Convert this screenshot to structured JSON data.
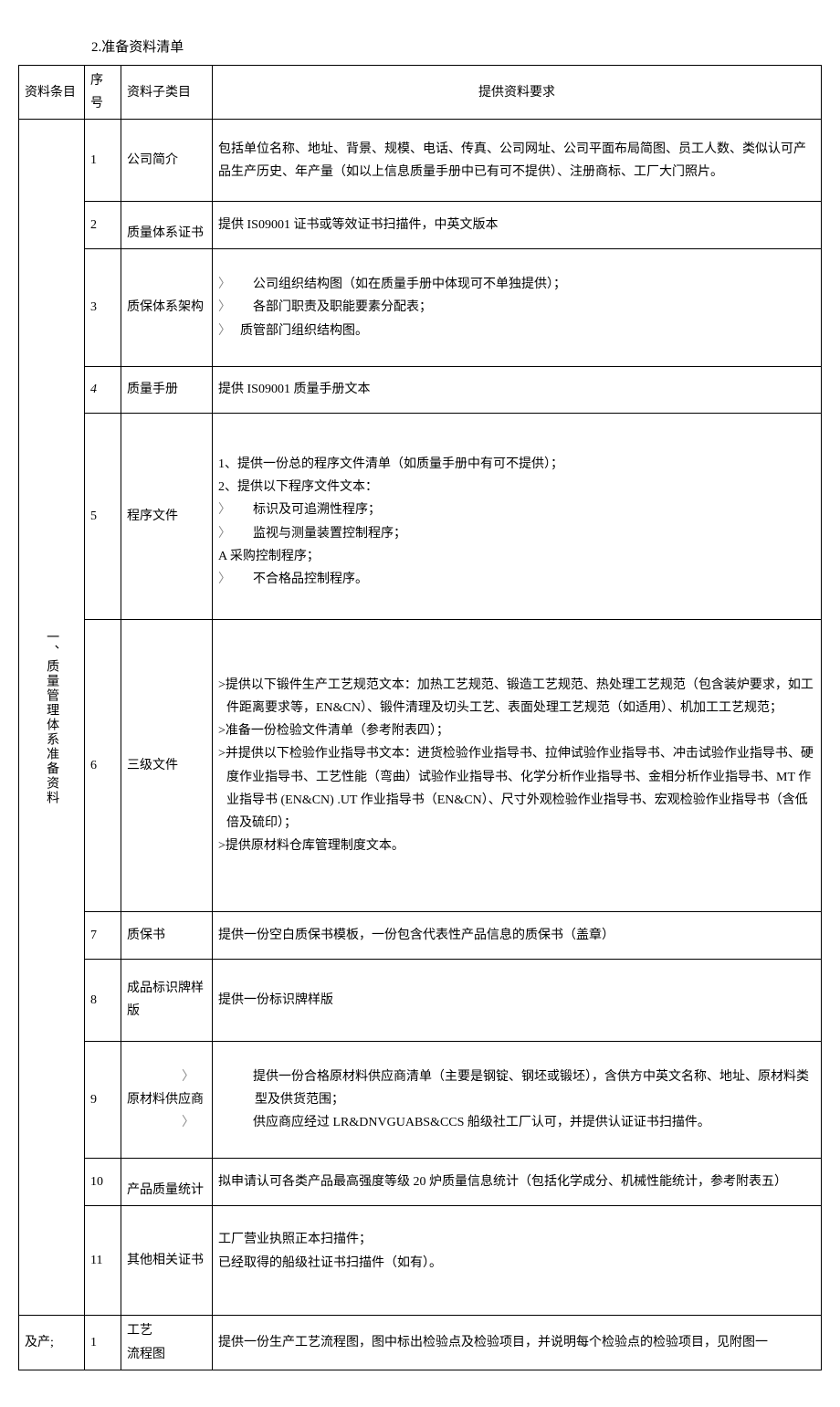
{
  "heading": "2.准备资料清单",
  "header": {
    "col1": "资料条目",
    "col2": "序号",
    "col3": "资料子类目",
    "col4": "提供资料要求"
  },
  "section1_label": "一、质量管理体系准备资料",
  "rows": [
    {
      "seq": "1",
      "cat": "公司简介",
      "req": "包括单位名称、地址、背景、规模、电话、传真、公司网址、公司平面布局简图、员工人数、类似认可产品生产历史、年产量（如以上信息质量手册中已有可不提供）、注册商标、工厂大门照片。"
    },
    {
      "seq": "2",
      "cat": "质量体系证书",
      "req": "提供 IS09001 证书或等效证书扫描件，中英文版本"
    },
    {
      "seq": "3",
      "cat": "质保体系架构",
      "req_lines": [
        {
          "bullet": true,
          "indent": true,
          "text": "公司组织结构图（如在质量手册中体现可不单独提供）；"
        },
        {
          "bullet": true,
          "indent": true,
          "text": "各部门职责及职能要素分配表；"
        },
        {
          "bullet": true,
          "indent": false,
          "text": "质管部门组织结构图。"
        }
      ]
    },
    {
      "seq": "4",
      "seq_italic": true,
      "cat": "质量手册",
      "req": "提供 IS09001 质量手册文本"
    },
    {
      "seq": "5",
      "cat": "程序文件",
      "req_lines": [
        {
          "plain": true,
          "text": "1、提供一份总的程序文件清单（如质量手册中有可不提供）；"
        },
        {
          "plain": true,
          "text": "2、提供以下程序文件文本："
        },
        {
          "bullet": true,
          "indent": true,
          "text": "标识及可追溯性程序；"
        },
        {
          "bullet": true,
          "indent": true,
          "text": "监视与测量装置控制程序；"
        },
        {
          "plain": true,
          "text": "A 采购控制程序；"
        },
        {
          "bullet": true,
          "indent": true,
          "text": "不合格品控制程序。"
        }
      ]
    },
    {
      "seq": "6",
      "cat": "三级文件",
      "req_lines": [
        {
          "hang": true,
          "text": ">提供以下锻件生产工艺规范文本：加热工艺规范、锻造工艺规范、热处理工艺规范（包含装炉要求，如工件距离要求等，EN&CN）、锻件清理及切头工艺、表面处理工艺规范（如适用）、机加工工艺规范；"
        },
        {
          "hang": true,
          "text": ">准备一份检验文件清单（参考附表四）；"
        },
        {
          "hang": true,
          "text": ">并提供以下检验作业指导书文本：进货检验作业指导书、拉伸试验作业指导书、冲击试验作业指导书、硬度作业指导书、工艺性能（弯曲）试验作业指导书、化学分析作业指导书、金相分析作业指导书、MT 作业指导书 (EN&CN) .UT 作业指导书（EN&CN）、尺寸外观检验作业指导书、宏观检验作业指导书（含低倍及硫印）；"
        },
        {
          "hang": true,
          "text": ">提供原材料仓库管理制度文本。"
        }
      ]
    },
    {
      "seq": "7",
      "cat": "质保书",
      "req": "提供一份空白质保书模板，一份包含代表性产品信息的质保书（盖章）"
    },
    {
      "seq": "8",
      "cat": "成品标识牌样版",
      "req": "提供一份标识牌样版"
    },
    {
      "seq": "9",
      "cat": "原材料供应商",
      "req_lines": [
        {
          "bullet": true,
          "indent": true,
          "text": "提供一份合格原材料供应商清单（主要是钢锭、钢坯或锻坯），含供方中英文名称、地址、原材料类型及供货范围；"
        },
        {
          "bullet": true,
          "indent": true,
          "text": "供应商应经过 LR&DNVGUABS&CCS 船级社工厂认可，并提供认证证书扫描件。"
        }
      ]
    },
    {
      "seq": "10",
      "cat": "产品质量统计",
      "req": "拟申请认可各类产品最高强度等级 20 炉质量信息统计（包括化学成分、机械性能统计，参考附表五）"
    },
    {
      "seq": "11",
      "cat": "其他相关证书",
      "req_lines": [
        {
          "plain": true,
          "text": "工厂营业执照正本扫描件；"
        },
        {
          "plain": true,
          "text": "已经取得的船级社证书扫描件（如有）。"
        }
      ]
    }
  ],
  "section2": {
    "label": "及产;",
    "seq": "1",
    "cat_line1": "工艺",
    "cat_line2": "流程图",
    "req": "提供一份生产工艺流程图，图中标出检验点及检验项目，并说明每个检验点的检验项目，见附图一"
  }
}
